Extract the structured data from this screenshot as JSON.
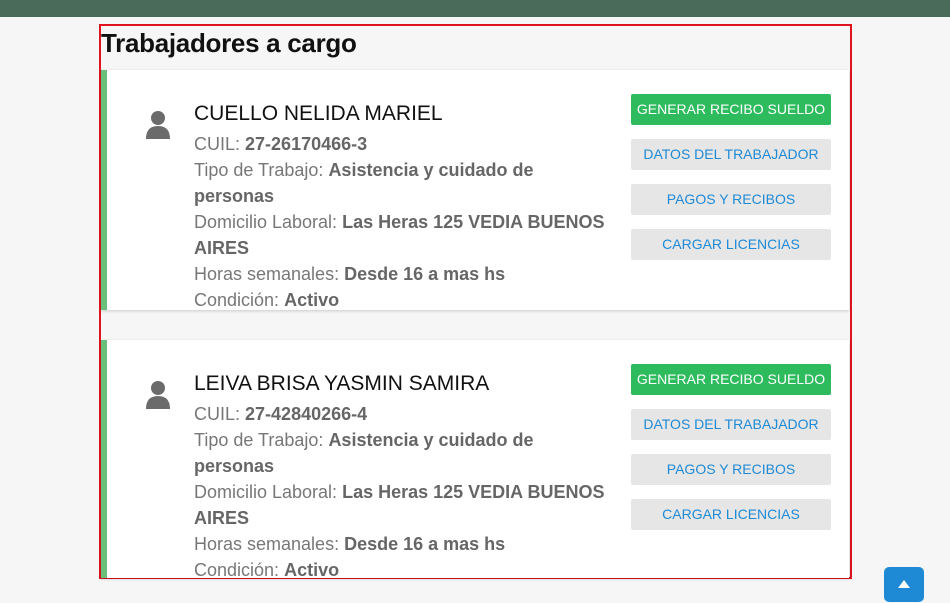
{
  "page": {
    "title": "Trabajadores a cargo"
  },
  "labels": {
    "cuil": "CUIL:",
    "tipo_trabajo": "Tipo de Trabajo:",
    "domicilio": "Domicilio Laboral:",
    "horas": "Horas semanales:",
    "condicion": "Condición:"
  },
  "actions": {
    "generar": "GENERAR RECIBO SUELDO",
    "datos": "DATOS DEL TRABAJADOR",
    "pagos": "PAGOS Y RECIBOS",
    "licencias": "CARGAR LICENCIAS"
  },
  "workers": [
    {
      "name": "CUELLO NELIDA MARIEL",
      "cuil": "27-26170466-3",
      "tipo_trabajo": "Asistencia y cuidado de personas",
      "domicilio": "Las Heras 125 VEDIA BUENOS AIRES",
      "horas": "Desde 16 a mas hs",
      "condicion": "Activo"
    },
    {
      "name": "LEIVA BRISA YASMIN SAMIRA",
      "cuil": "27-42840266-4",
      "tipo_trabajo": "Asistencia y cuidado de personas",
      "domicilio": "Las Heras 125 VEDIA BUENOS AIRES",
      "horas": "Desde 16 a mas hs",
      "condicion": "Activo"
    }
  ],
  "icons": {
    "avatar": "user-icon",
    "scroll_top": "chevron-up-icon"
  },
  "colors": {
    "accent_green": "#2dbb5d",
    "link_blue": "#1e8ad6",
    "card_border": "#6abf7a",
    "frame": "#e0141e"
  }
}
